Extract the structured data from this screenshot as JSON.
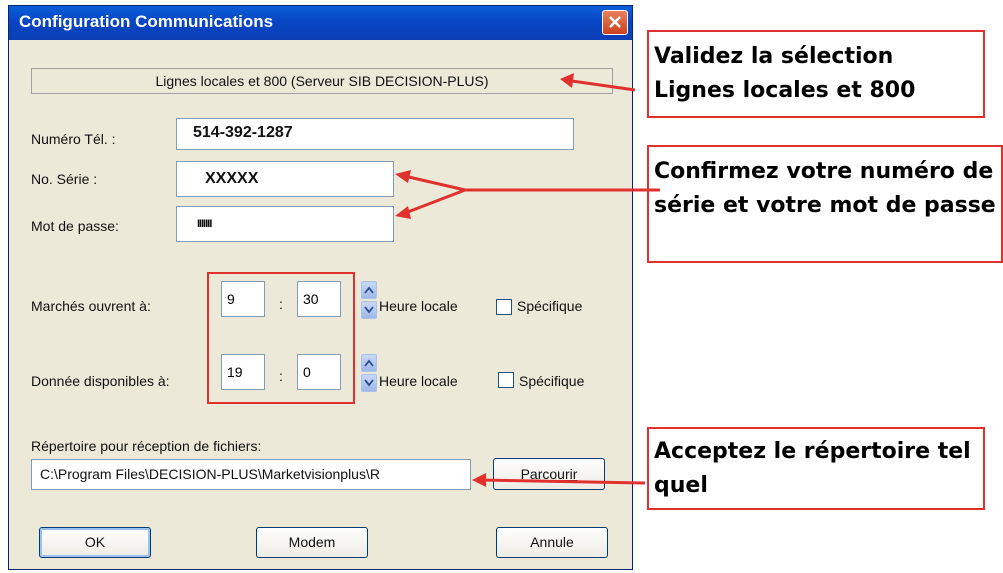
{
  "window": {
    "title": "Configuration Communications"
  },
  "banner": "Lignes locales et 800 (Serveur SIB DECISION-PLUS)",
  "fields": {
    "phone": {
      "label": "Numéro Tél. :",
      "value": "514-392-1287"
    },
    "serial": {
      "label": "No. Série :",
      "value": "XXXXX"
    },
    "password": {
      "label": "Mot de passe:",
      "value": "IIIIIII"
    }
  },
  "markets_open": {
    "label": "Marchés ouvrent à:",
    "hour": "9",
    "separator": ":",
    "minute": "30",
    "time_label": "Heure locale",
    "checkbox_label": "Spécifique"
  },
  "data_available": {
    "label": "Donnée disponibles à:",
    "hour": "19",
    "separator": ":",
    "minute": "0",
    "time_label": "Heure locale",
    "checkbox_label": "Spécifique"
  },
  "directory": {
    "label": "Répertoire pour réception de fichiers:",
    "value": "C:\\Program Files\\DECISION-PLUS\\Marketvisionplus\\R",
    "browse_label": "Parcourir"
  },
  "buttons": {
    "ok": "OK",
    "modem": "Modem",
    "cancel": "Annule"
  },
  "callouts": {
    "validate": [
      "Validez la sélection",
      "Lignes locales et 800"
    ],
    "confirm": [
      "Confirmez votre numéro de",
      "série et votre mot de passe"
    ],
    "accept": [
      "Acceptez le répertoire tel",
      "quel"
    ]
  },
  "colors": {
    "annotation_red": "#e0312f",
    "titlebar_blue": "#0a46c4",
    "dialog_bg": "#ece9d8"
  },
  "icons": {
    "close": "close-x-icon",
    "spin": "spin-arrows-icon"
  }
}
